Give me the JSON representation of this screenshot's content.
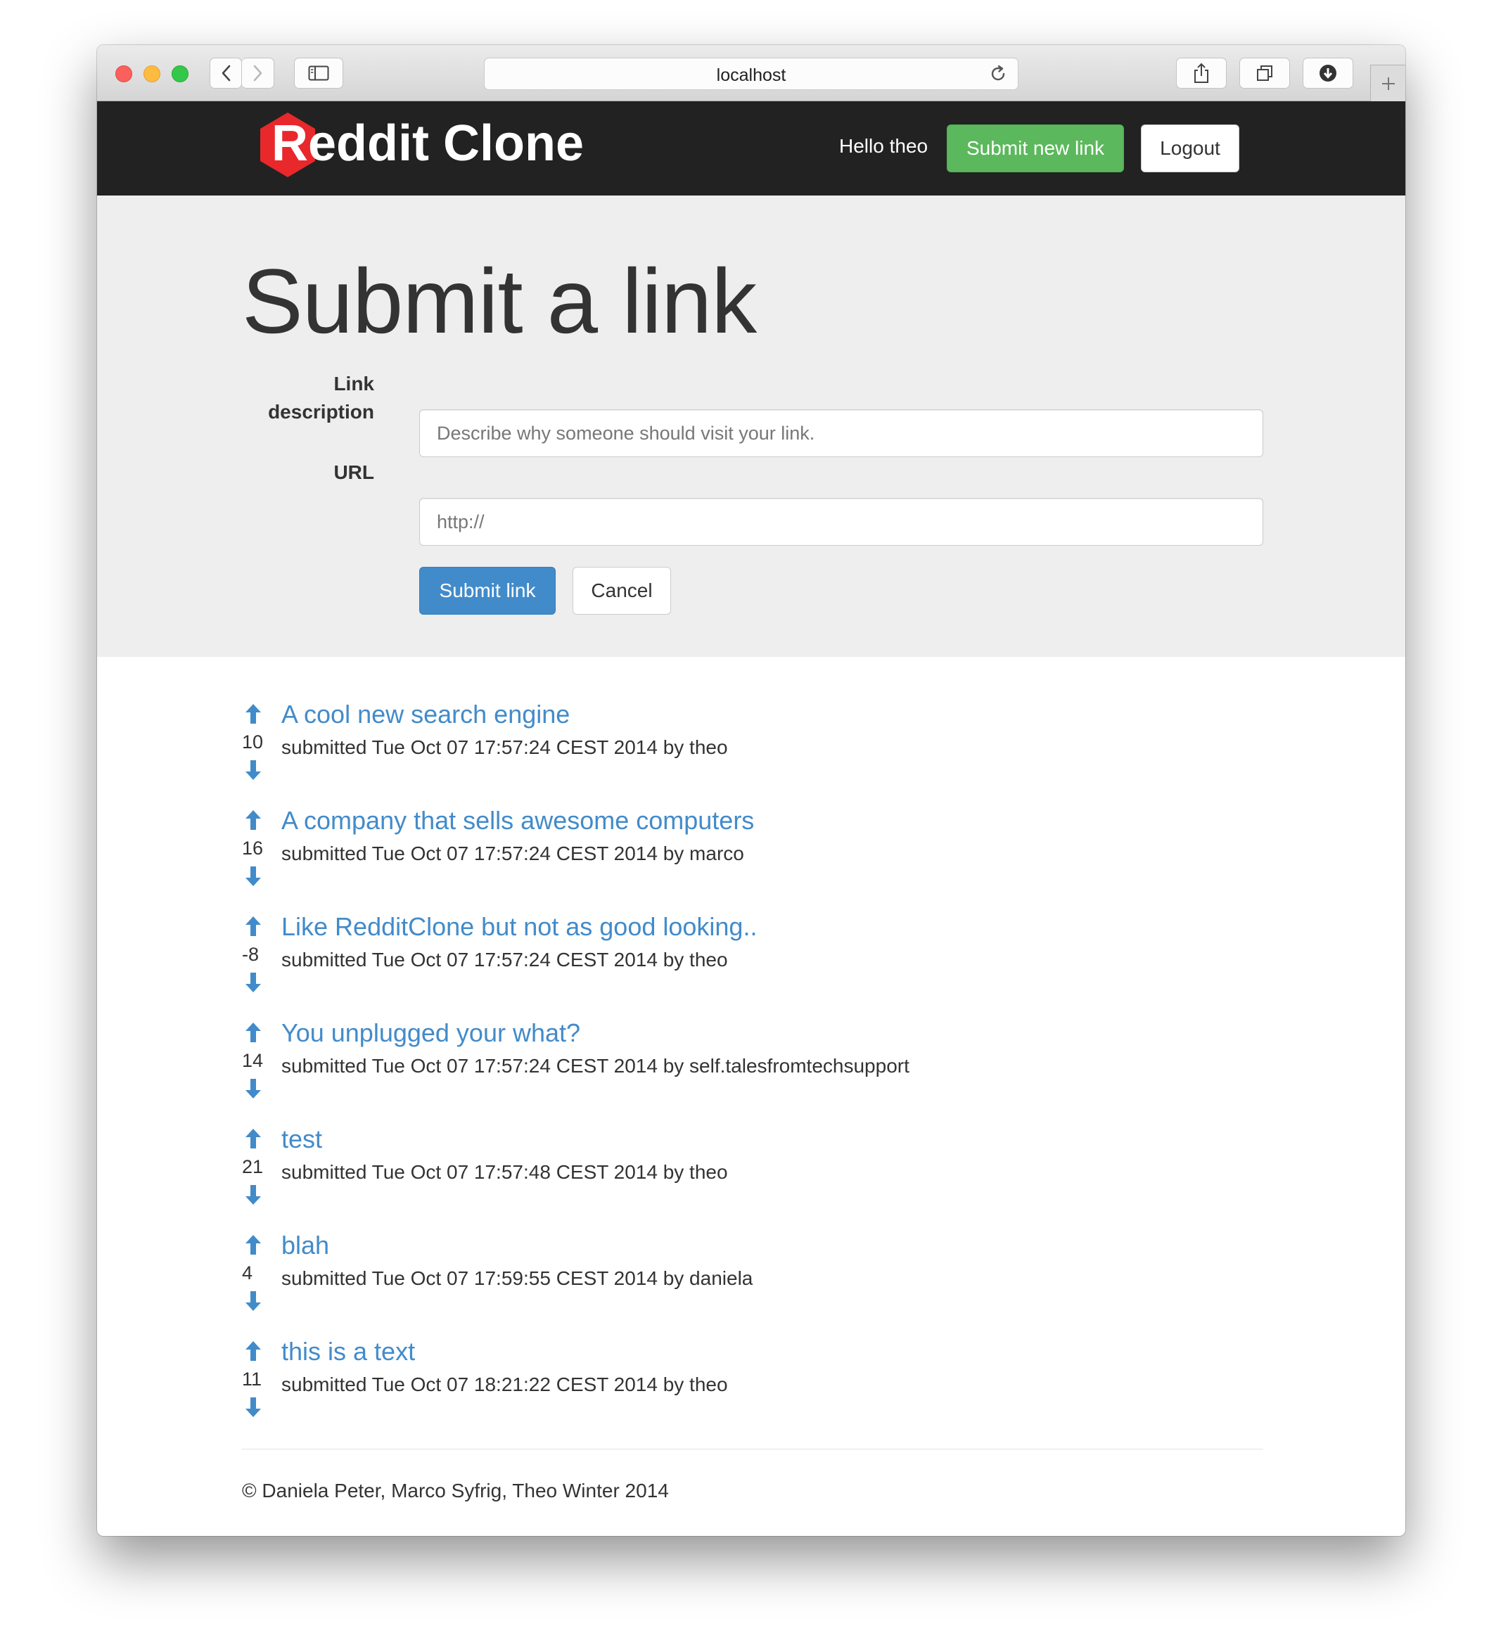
{
  "browser": {
    "url": "localhost"
  },
  "navbar": {
    "brand": "Reddit Clone",
    "greeting": "Hello theo",
    "submit_new_link": "Submit new link",
    "logout": "Logout"
  },
  "form": {
    "title": "Submit a link",
    "description_label_line1": "Link",
    "description_label_line2": "description",
    "description_placeholder": "Describe why someone should visit your link.",
    "url_label": "URL",
    "url_placeholder": "http://",
    "submit_button": "Submit link",
    "cancel_button": "Cancel"
  },
  "links": [
    {
      "title": "A cool new search engine",
      "score": "10",
      "meta": "submitted Tue Oct 07 17:57:24 CEST 2014 by theo"
    },
    {
      "title": "A company that sells awesome computers",
      "score": "16",
      "meta": "submitted Tue Oct 07 17:57:24 CEST 2014 by marco"
    },
    {
      "title": "Like RedditClone but not as good looking..",
      "score": "-8",
      "meta": "submitted Tue Oct 07 17:57:24 CEST 2014 by theo"
    },
    {
      "title": "You unplugged your what?",
      "score": "14",
      "meta": "submitted Tue Oct 07 17:57:24 CEST 2014 by self.talesfromtechsupport"
    },
    {
      "title": "test",
      "score": "21",
      "meta": "submitted Tue Oct 07 17:57:48 CEST 2014 by theo"
    },
    {
      "title": "blah",
      "score": "4",
      "meta": "submitted Tue Oct 07 17:59:55 CEST 2014 by daniela"
    },
    {
      "title": "this is a text",
      "score": "11",
      "meta": "submitted Tue Oct 07 18:21:22 CEST 2014 by theo"
    }
  ],
  "footer": {
    "text": "© Daniela Peter, Marco Syfrig, Theo Winter 2014"
  },
  "colors": {
    "navbar_bg": "#222222",
    "link_blue": "#428bca",
    "success_green": "#5cb85c",
    "brand_red": "#e8282b",
    "jumbotron_bg": "#eeeeee"
  },
  "icons": {
    "upvote": "arrow-up-icon",
    "downvote": "arrow-down-icon",
    "back": "chevron-left-icon",
    "forward": "chevron-right-icon",
    "sidebar": "sidebar-icon",
    "reload": "reload-icon",
    "share": "share-icon",
    "tabs": "tabs-icon",
    "downloads": "download-icon",
    "new_tab": "plus-icon",
    "logo": "hexagon-logo-icon"
  }
}
